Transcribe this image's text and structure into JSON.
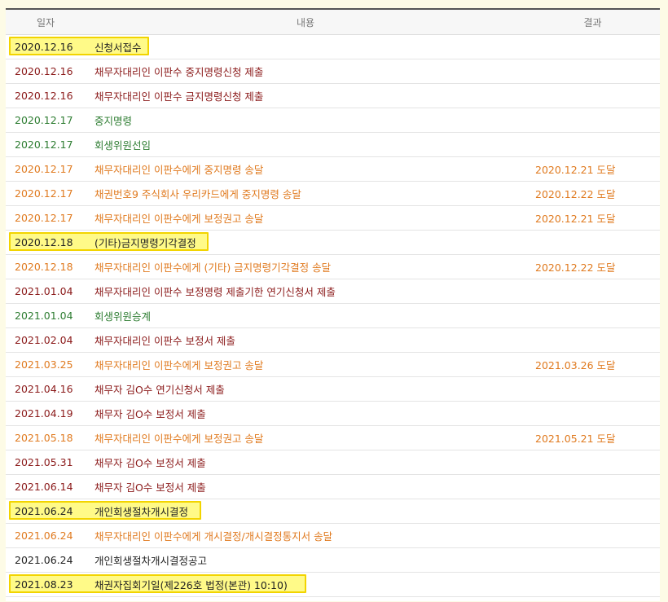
{
  "headers": {
    "date": "일자",
    "content": "내용",
    "result": "결과"
  },
  "colors": {
    "red": "#8b1a1a",
    "green": "#2e7d32",
    "orange": "#e07a1f",
    "black": "#222222",
    "highlight": "#fffa88"
  },
  "rows": [
    {
      "date": "2020.12.16",
      "content": "신청서접수",
      "result": "",
      "color": "black",
      "highlight": true,
      "hl_w": 172
    },
    {
      "date": "2020.12.16",
      "content": "채무자대리인 이판수 중지명령신청 제출",
      "result": "",
      "color": "red",
      "highlight": false
    },
    {
      "date": "2020.12.16",
      "content": "채무자대리인 이판수 금지명령신청 제출",
      "result": "",
      "color": "red",
      "highlight": false
    },
    {
      "date": "2020.12.17",
      "content": "중지명령",
      "result": "",
      "color": "green",
      "highlight": false
    },
    {
      "date": "2020.12.17",
      "content": "회생위원선임",
      "result": "",
      "color": "green",
      "highlight": false
    },
    {
      "date": "2020.12.17",
      "content": "채무자대리인 이판수에게 중지명령 송달",
      "result": "2020.12.21 도달",
      "color": "orange",
      "highlight": false
    },
    {
      "date": "2020.12.17",
      "content": "채권번호9 주식회사 우리카드에게 중지명령 송달",
      "result": "2020.12.22 도달",
      "color": "orange",
      "highlight": false
    },
    {
      "date": "2020.12.17",
      "content": "채무자대리인 이판수에게 보정권고 송달",
      "result": "2020.12.21 도달",
      "color": "orange",
      "highlight": false
    },
    {
      "date": "2020.12.18",
      "content": "(기타)금지명령기각결정",
      "result": "",
      "color": "black",
      "highlight": true,
      "hl_w": 245
    },
    {
      "date": "2020.12.18",
      "content": "채무자대리인 이판수에게 (기타) 금지명령기각결정 송달",
      "result": "2020.12.22 도달",
      "color": "orange",
      "highlight": false
    },
    {
      "date": "2021.01.04",
      "content": "채무자대리인 이판수 보정명령 제출기한 연기신청서 제출",
      "result": "",
      "color": "red",
      "highlight": false
    },
    {
      "date": "2021.01.04",
      "content": "회생위원승계",
      "result": "",
      "color": "green",
      "highlight": false
    },
    {
      "date": "2021.02.04",
      "content": "채무자대리인 이판수 보정서 제출",
      "result": "",
      "color": "red",
      "highlight": false
    },
    {
      "date": "2021.03.25",
      "content": "채무자대리인 이판수에게 보정권고 송달",
      "result": "2021.03.26 도달",
      "color": "orange",
      "highlight": false
    },
    {
      "date": "2021.04.16",
      "content": "채무자 김O수 연기신청서 제출",
      "result": "",
      "color": "red",
      "highlight": false
    },
    {
      "date": "2021.04.19",
      "content": "채무자 김O수 보정서 제출",
      "result": "",
      "color": "red",
      "highlight": false
    },
    {
      "date": "2021.05.18",
      "content": "채무자대리인 이판수에게 보정권고 송달",
      "result": "2021.05.21 도달",
      "color": "orange",
      "highlight": false
    },
    {
      "date": "2021.05.31",
      "content": "채무자 김O수 보정서 제출",
      "result": "",
      "color": "red",
      "highlight": false
    },
    {
      "date": "2021.06.14",
      "content": "채무자 김O수 보정서 제출",
      "result": "",
      "color": "red",
      "highlight": false
    },
    {
      "date": "2021.06.24",
      "content": "개인회생절차개시결정",
      "result": "",
      "color": "black",
      "highlight": true,
      "hl_w": 236
    },
    {
      "date": "2021.06.24",
      "content": "채무자대리인 이판수에게 개시결정/개시결정통지서 송달",
      "result": "",
      "color": "orange",
      "highlight": false
    },
    {
      "date": "2021.06.24",
      "content": "개인회생절차개시결정공고",
      "result": "",
      "color": "black",
      "highlight": false
    },
    {
      "date": "2021.08.23",
      "content": "채권자집회기일(제226호 법정(본관) 10:10)",
      "result": "",
      "color": "black",
      "highlight": true,
      "hl_w": 365
    }
  ]
}
